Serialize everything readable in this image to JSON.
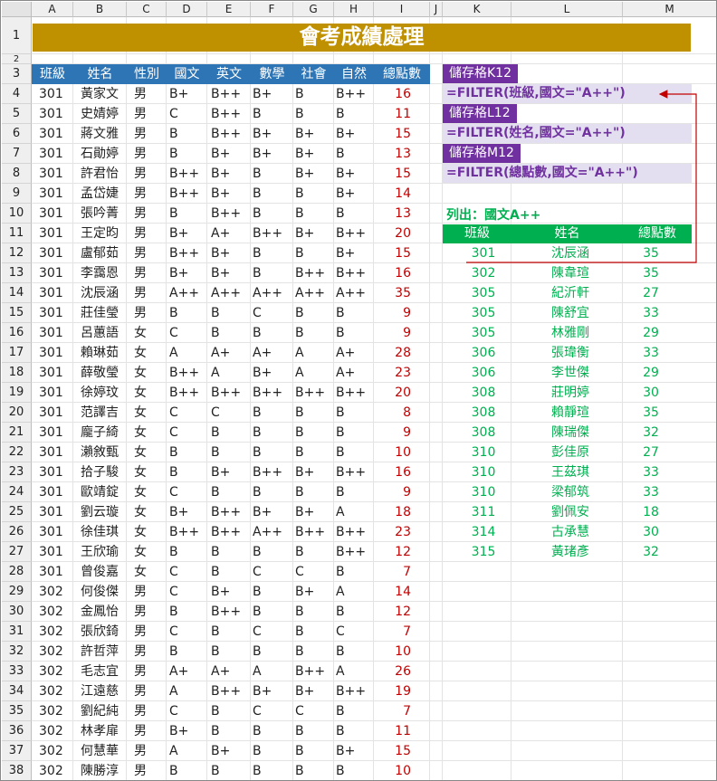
{
  "columns": [
    "A",
    "B",
    "C",
    "D",
    "E",
    "F",
    "G",
    "H",
    "I",
    "J",
    "K",
    "L",
    "M"
  ],
  "rows": [
    "1",
    "2",
    "3",
    "4",
    "5",
    "6",
    "7",
    "8",
    "9",
    "10",
    "11",
    "12",
    "13",
    "14",
    "15",
    "16",
    "17",
    "18",
    "19",
    "20",
    "21",
    "22",
    "23",
    "24",
    "25",
    "26",
    "27",
    "28",
    "29",
    "30",
    "31",
    "32",
    "33",
    "34",
    "35",
    "36",
    "37",
    "38"
  ],
  "title": "會考成績處理",
  "table_headers": [
    "班級",
    "姓名",
    "性別",
    "國文",
    "英文",
    "數學",
    "社會",
    "自然",
    "總點數"
  ],
  "students": [
    [
      "301",
      "黃家文",
      "男",
      "B+",
      "B++",
      "B+",
      "B",
      "B++",
      "16"
    ],
    [
      "301",
      "史婧婷",
      "男",
      "C",
      "B++",
      "B",
      "B",
      "B",
      "11"
    ],
    [
      "301",
      "蔣文雅",
      "男",
      "B",
      "B++",
      "B+",
      "B+",
      "B+",
      "15"
    ],
    [
      "301",
      "石勛婷",
      "男",
      "B",
      "B+",
      "B+",
      "B+",
      "B",
      "13"
    ],
    [
      "301",
      "許君怡",
      "男",
      "B++",
      "B+",
      "B",
      "B+",
      "B+",
      "15"
    ],
    [
      "301",
      "孟岱婕",
      "男",
      "B++",
      "B+",
      "B",
      "B",
      "B+",
      "14"
    ],
    [
      "301",
      "張吟菁",
      "男",
      "B",
      "B++",
      "B",
      "B",
      "B",
      "13"
    ],
    [
      "301",
      "王定昀",
      "男",
      "B+",
      "A+",
      "B++",
      "B+",
      "B++",
      "20"
    ],
    [
      "301",
      "盧郁茹",
      "男",
      "B++",
      "B+",
      "B",
      "B",
      "B+",
      "15"
    ],
    [
      "301",
      "李靄恩",
      "男",
      "B+",
      "B+",
      "B",
      "B++",
      "B++",
      "16"
    ],
    [
      "301",
      "沈辰涵",
      "男",
      "A++",
      "A++",
      "A++",
      "A++",
      "A++",
      "35"
    ],
    [
      "301",
      "莊佳瑩",
      "男",
      "B",
      "B",
      "C",
      "B",
      "B",
      "9"
    ],
    [
      "301",
      "呂蕙語",
      "女",
      "C",
      "B",
      "B",
      "B",
      "B",
      "9"
    ],
    [
      "301",
      "賴琳茹",
      "女",
      "A",
      "A+",
      "A+",
      "A",
      "A+",
      "28"
    ],
    [
      "301",
      "薛敬瑩",
      "女",
      "B++",
      "A",
      "B+",
      "A",
      "A+",
      "23"
    ],
    [
      "301",
      "徐婷玟",
      "女",
      "B++",
      "B++",
      "B++",
      "B++",
      "B++",
      "20"
    ],
    [
      "301",
      "范譯吉",
      "女",
      "C",
      "C",
      "B",
      "B",
      "B",
      "8"
    ],
    [
      "301",
      "龐子綺",
      "女",
      "C",
      "B",
      "B",
      "B",
      "B",
      "9"
    ],
    [
      "301",
      "瀨敘甄",
      "女",
      "B",
      "B",
      "B",
      "B",
      "B",
      "10"
    ],
    [
      "301",
      "拾子駿",
      "女",
      "B",
      "B+",
      "B++",
      "B+",
      "B++",
      "16"
    ],
    [
      "301",
      "歐靖錠",
      "女",
      "C",
      "B",
      "B",
      "B",
      "B",
      "9"
    ],
    [
      "301",
      "劉云璇",
      "女",
      "B+",
      "B++",
      "B+",
      "B+",
      "A",
      "18"
    ],
    [
      "301",
      "徐佳琪",
      "女",
      "B++",
      "B++",
      "A++",
      "B++",
      "B++",
      "23"
    ],
    [
      "301",
      "王欣瑜",
      "女",
      "B",
      "B",
      "B",
      "B",
      "B++",
      "12"
    ],
    [
      "301",
      "曾俊嘉",
      "女",
      "C",
      "B",
      "C",
      "C",
      "B",
      "7"
    ],
    [
      "302",
      "何俊傑",
      "男",
      "C",
      "B+",
      "B",
      "B+",
      "A",
      "14"
    ],
    [
      "302",
      "金鳳怡",
      "男",
      "B",
      "B++",
      "B",
      "B",
      "B",
      "12"
    ],
    [
      "302",
      "張欣錡",
      "男",
      "C",
      "B",
      "C",
      "B",
      "C",
      "7"
    ],
    [
      "302",
      "許哲萍",
      "男",
      "B",
      "B",
      "B",
      "B",
      "B",
      "10"
    ],
    [
      "302",
      "毛志宜",
      "男",
      "A+",
      "A+",
      "A",
      "B++",
      "A",
      "26"
    ],
    [
      "302",
      "江遠慈",
      "男",
      "A",
      "B++",
      "B+",
      "B+",
      "B++",
      "19"
    ],
    [
      "302",
      "劉紀純",
      "男",
      "C",
      "B",
      "C",
      "C",
      "B",
      "7"
    ],
    [
      "302",
      "林孝扉",
      "男",
      "B+",
      "B",
      "B",
      "B",
      "B",
      "11"
    ],
    [
      "302",
      "何慧華",
      "男",
      "A",
      "B+",
      "B",
      "B",
      "B+",
      "15"
    ],
    [
      "302",
      "陳勝淳",
      "男",
      "B",
      "B",
      "B",
      "B",
      "B",
      "10"
    ]
  ],
  "formula_labels": [
    "儲存格K12",
    "儲存格L12",
    "儲存格M12"
  ],
  "formulas": [
    "=FILTER(班級,國文=\"A++\")",
    "=FILTER(姓名,國文=\"A++\")",
    "=FILTER(總點數,國文=\"A++\")"
  ],
  "list_title": "列出：國文A++",
  "result_headers": [
    "班級",
    "姓名",
    "總點數"
  ],
  "results": [
    [
      "301",
      "沈辰涵",
      "35"
    ],
    [
      "302",
      "陳韋瑄",
      "35"
    ],
    [
      "305",
      "紀沂軒",
      "27"
    ],
    [
      "305",
      "陳舒宜",
      "33"
    ],
    [
      "305",
      "林雅剛",
      "29"
    ],
    [
      "306",
      "張瑋衡",
      "33"
    ],
    [
      "306",
      "李世傑",
      "29"
    ],
    [
      "308",
      "莊明婷",
      "30"
    ],
    [
      "308",
      "賴靜瑄",
      "35"
    ],
    [
      "308",
      "陳瑞傑",
      "32"
    ],
    [
      "310",
      "彭佳原",
      "27"
    ],
    [
      "310",
      "王茲琪",
      "33"
    ],
    [
      "310",
      "梁郁筑",
      "33"
    ],
    [
      "311",
      "劉佩安",
      "18"
    ],
    [
      "314",
      "古承慧",
      "30"
    ],
    [
      "315",
      "黃琽彥",
      "32"
    ]
  ],
  "colors": {
    "title_bg": "#bf9000",
    "header_bg": "#2e75b6",
    "label_bg": "#7030a0",
    "formula_bg": "#e4dff0",
    "green": "#00b050",
    "red": "#c00000"
  }
}
